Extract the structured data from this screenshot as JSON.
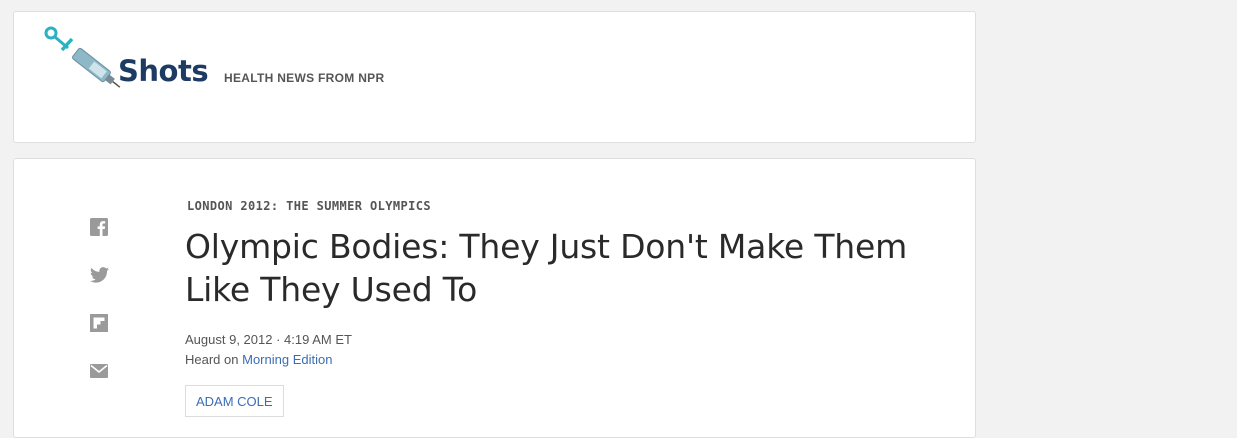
{
  "header": {
    "brand_name": "Shots",
    "tagline": "HEALTH NEWS FROM NPR",
    "logo_icon": "syringe-icon",
    "brand_color": "#1e3c63",
    "accent_color": "#2bb1c4"
  },
  "article": {
    "section": "LONDON 2012: THE SUMMER OLYMPICS",
    "headline": "Olympic Bodies: They Just Don't Make Them Like They Used To",
    "date": "August 9, 2012 · 4:19 AM ET",
    "heard_on_prefix": "Heard on",
    "heard_on_program": "Morning Edition",
    "author": "ADAM COLE",
    "link_color": "#3a6db5"
  },
  "share": {
    "items": [
      {
        "icon": "facebook-icon"
      },
      {
        "icon": "twitter-icon"
      },
      {
        "icon": "flipboard-icon"
      },
      {
        "icon": "email-icon"
      }
    ]
  }
}
